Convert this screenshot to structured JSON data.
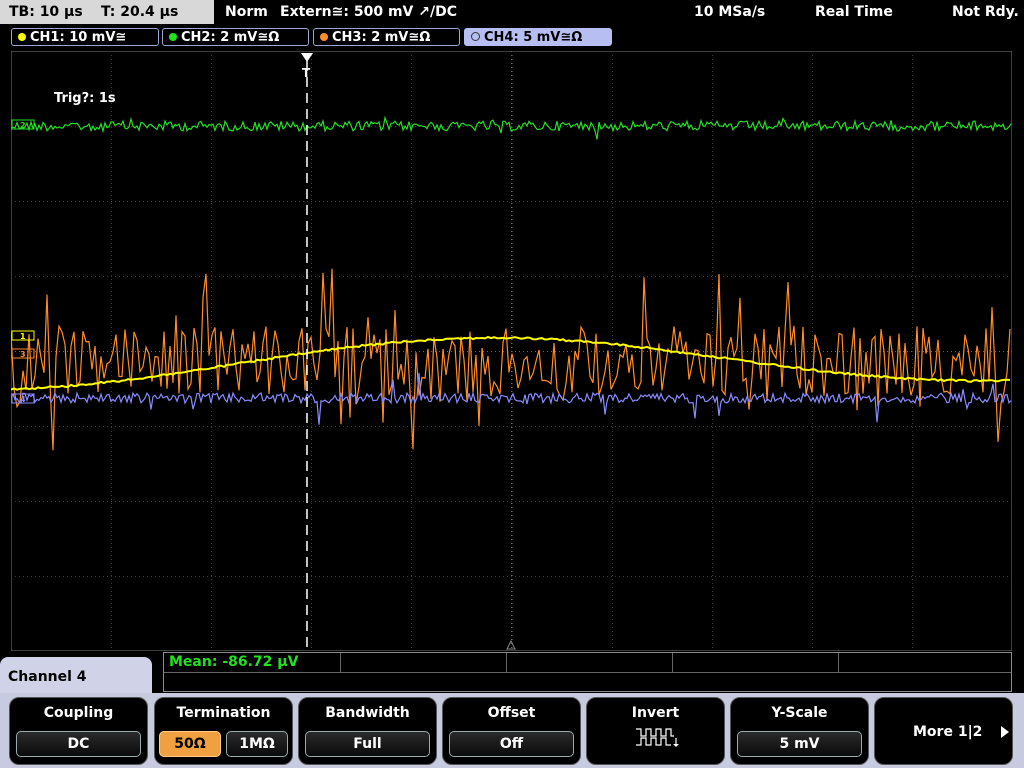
{
  "status": {
    "timebase": "TB: 10 µs",
    "trigger_time": "T: 20.4 µs",
    "mode": "Norm",
    "trigger_info": "Extern≅: 500 mV ↗/DC",
    "sample_rate": "10 MSa/s",
    "acq_mode": "Real Time",
    "state": "Not Rdy."
  },
  "channels": [
    {
      "label": "CH1: 10 mV≅",
      "color": "#ffff00"
    },
    {
      "label": "CH2: 2 mV≅Ω",
      "color": "#22e022"
    },
    {
      "label": "CH3: 2 mV≅Ω",
      "color": "#ff8c28"
    },
    {
      "label": "CH4: 5 mV≅Ω",
      "color": "#8a8aff"
    }
  ],
  "overlay": {
    "trig_timeout": "Trig?: 1s"
  },
  "markers": {
    "ch1": "1",
    "ch2": "2",
    "ch3": "3",
    "ch4": "4",
    "trigger": "T"
  },
  "measurement": {
    "mean": "Mean: -86.72 µV"
  },
  "menu": {
    "title": "Channel 4",
    "coupling": {
      "label": "Coupling",
      "value": "DC"
    },
    "termination": {
      "label": "Termination",
      "opt1": "50Ω",
      "opt2": "1MΩ"
    },
    "bandwidth": {
      "label": "Bandwidth",
      "value": "Full"
    },
    "offset": {
      "label": "Offset",
      "value": "Off"
    },
    "invert": {
      "label": "Invert"
    },
    "yscale": {
      "label": "Y-Scale",
      "value": "5 mV"
    },
    "more": {
      "label": "More 1|2"
    }
  }
}
